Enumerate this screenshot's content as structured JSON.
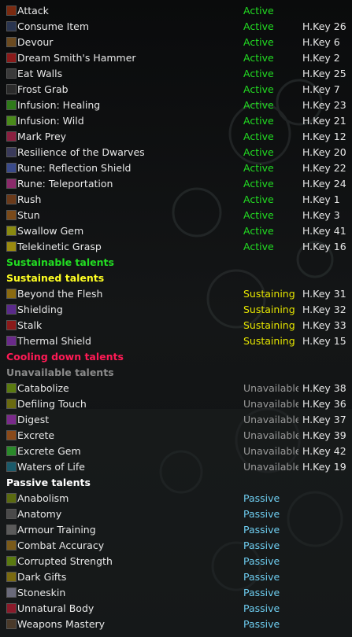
{
  "colors": {
    "active": "#22dd22",
    "sustaining": "#e6e600",
    "unavailable": "#9a9a9a",
    "passive": "#6ecdf0",
    "hdr_sustainable": "#22dd22",
    "hdr_sustained": "#ffff22",
    "hdr_cooling": "#ff1a55",
    "hdr_unavailable": "#8a8a8a",
    "hdr_passive": "#ffffff"
  },
  "active_talents": [
    {
      "name": "Attack",
      "status": "Active",
      "hkey": "",
      "icon": "attack-icon",
      "color": "#7a2a10"
    },
    {
      "name": "Consume Item",
      "status": "Active",
      "hkey": "H.Key 26",
      "icon": "consume-item-icon",
      "color": "#2a3550"
    },
    {
      "name": "Devour",
      "status": "Active",
      "hkey": "H.Key 6",
      "icon": "devour-icon",
      "color": "#6b4a20"
    },
    {
      "name": "Dream Smith's Hammer",
      "status": "Active",
      "hkey": "H.Key 2",
      "icon": "hammer-icon",
      "color": "#8a1a1a"
    },
    {
      "name": "Eat Walls",
      "status": "Active",
      "hkey": "H.Key 25",
      "icon": "eat-walls-icon",
      "color": "#3a3a3a"
    },
    {
      "name": "Frost Grab",
      "status": "Active",
      "hkey": "H.Key 7",
      "icon": "frost-grab-icon",
      "color": "#2a2a2a"
    },
    {
      "name": "Infusion: Healing",
      "status": "Active",
      "hkey": "H.Key 23",
      "icon": "infusion-healing-icon",
      "color": "#2f7a1a"
    },
    {
      "name": "Infusion: Wild",
      "status": "Active",
      "hkey": "H.Key 21",
      "icon": "infusion-wild-icon",
      "color": "#4a8a1a"
    },
    {
      "name": "Mark Prey",
      "status": "Active",
      "hkey": "H.Key 12",
      "icon": "mark-prey-icon",
      "color": "#8a2040"
    },
    {
      "name": "Resilience of the Dwarves",
      "status": "Active",
      "hkey": "H.Key 20",
      "icon": "resilience-icon",
      "color": "#3a3a5a"
    },
    {
      "name": "Rune: Reflection Shield",
      "status": "Active",
      "hkey": "H.Key 22",
      "icon": "rune-reflection-icon",
      "color": "#3a4a8a"
    },
    {
      "name": "Rune: Teleportation",
      "status": "Active",
      "hkey": "H.Key 24",
      "icon": "rune-teleport-icon",
      "color": "#8a2a6a"
    },
    {
      "name": "Rush",
      "status": "Active",
      "hkey": "H.Key 1",
      "icon": "rush-icon",
      "color": "#6a3a1a"
    },
    {
      "name": "Stun",
      "status": "Active",
      "hkey": "H.Key 3",
      "icon": "stun-icon",
      "color": "#7a4a1a"
    },
    {
      "name": "Swallow Gem",
      "status": "Active",
      "hkey": "H.Key 41",
      "icon": "swallow-gem-icon",
      "color": "#8a8a10"
    },
    {
      "name": "Telekinetic Grasp",
      "status": "Active",
      "hkey": "H.Key 16",
      "icon": "telekinetic-grasp-icon",
      "color": "#9a8a10"
    }
  ],
  "headers": {
    "sustainable": "Sustainable talents",
    "sustained": "Sustained talents",
    "cooling": "Cooling down talents",
    "unavailable": "Unavailable talents",
    "passive": "Passive talents"
  },
  "sustained_talents": [
    {
      "name": "Beyond the Flesh",
      "status": "Sustaining",
      "hkey": "H.Key 31",
      "icon": "beyond-flesh-icon",
      "color": "#8a6a10"
    },
    {
      "name": "Shielding",
      "status": "Sustaining",
      "hkey": "H.Key 32",
      "icon": "shielding-icon",
      "color": "#5a2a8a"
    },
    {
      "name": "Stalk",
      "status": "Sustaining",
      "hkey": "H.Key 33",
      "icon": "stalk-icon",
      "color": "#8a1a1a"
    },
    {
      "name": "Thermal Shield",
      "status": "Sustaining",
      "hkey": "H.Key 15",
      "icon": "thermal-shield-icon",
      "color": "#6a2a8a"
    }
  ],
  "unavailable_talents": [
    {
      "name": "Catabolize",
      "status": "Unavailable",
      "hkey": "H.Key 38",
      "icon": "catabolize-icon",
      "color": "#5a7a10"
    },
    {
      "name": "Defiling Touch",
      "status": "Unavailable",
      "hkey": "H.Key 36",
      "icon": "defiling-touch-icon",
      "color": "#6a6a10"
    },
    {
      "name": "Digest",
      "status": "Unavailable",
      "hkey": "H.Key 37",
      "icon": "digest-icon",
      "color": "#7a2a8a"
    },
    {
      "name": "Excrete",
      "status": "Unavailable",
      "hkey": "H.Key 39",
      "icon": "excrete-icon",
      "color": "#8a4a1a"
    },
    {
      "name": "Excrete Gem",
      "status": "Unavailable",
      "hkey": "H.Key 42",
      "icon": "excrete-gem-icon",
      "color": "#2a8a2a"
    },
    {
      "name": "Waters of Life",
      "status": "Unavailable",
      "hkey": "H.Key 19",
      "icon": "waters-life-icon",
      "color": "#1a5a6a"
    }
  ],
  "passive_talents": [
    {
      "name": "Anabolism",
      "status": "Passive",
      "hkey": "",
      "icon": "anabolism-icon",
      "color": "#5a6a10"
    },
    {
      "name": "Anatomy",
      "status": "Passive",
      "hkey": "",
      "icon": "anatomy-icon",
      "color": "#4a4a4a"
    },
    {
      "name": "Armour Training",
      "status": "Passive",
      "hkey": "",
      "icon": "armour-training-icon",
      "color": "#5a5a5a"
    },
    {
      "name": "Combat Accuracy",
      "status": "Passive",
      "hkey": "",
      "icon": "combat-accuracy-icon",
      "color": "#7a5a1a"
    },
    {
      "name": "Corrupted Strength",
      "status": "Passive",
      "hkey": "",
      "icon": "corrupted-strength-icon",
      "color": "#5a7a10"
    },
    {
      "name": "Dark Gifts",
      "status": "Passive",
      "hkey": "",
      "icon": "dark-gifts-icon",
      "color": "#7a6a10"
    },
    {
      "name": "Stoneskin",
      "status": "Passive",
      "hkey": "",
      "icon": "stoneskin-icon",
      "color": "#6a6a7a"
    },
    {
      "name": "Unnatural Body",
      "status": "Passive",
      "hkey": "",
      "icon": "unnatural-body-icon",
      "color": "#8a1a2a"
    },
    {
      "name": "Weapons Mastery",
      "status": "Passive",
      "hkey": "",
      "icon": "weapons-mastery-icon",
      "color": "#4a3a2a"
    }
  ]
}
